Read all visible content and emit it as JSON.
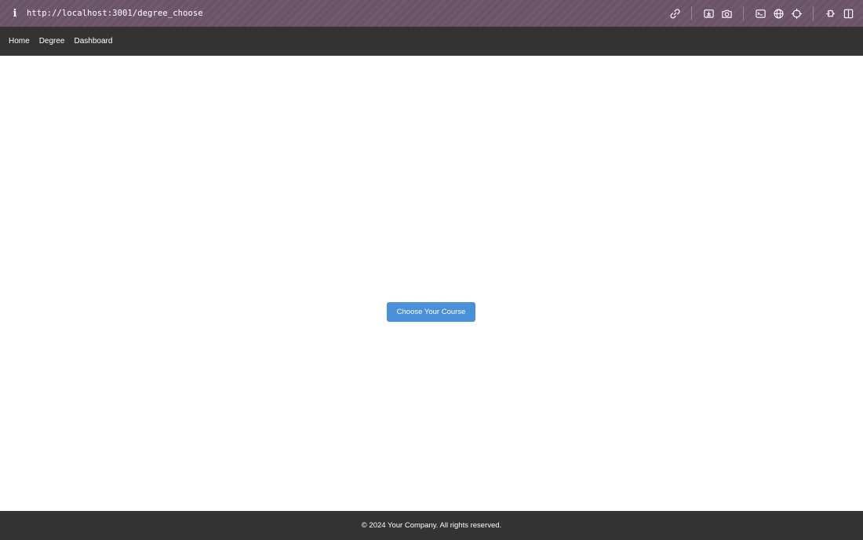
{
  "browser": {
    "info_icon": "i",
    "url": "http://localhost:3001/degree_choose",
    "toolbar_icons": [
      "link-icon",
      "download-icon",
      "camera-icon",
      "terminal-icon",
      "globe-icon",
      "crosshair-icon",
      "extensions-icon",
      "split-view-icon"
    ]
  },
  "nav": {
    "links": [
      {
        "label": "Home"
      },
      {
        "label": "Degree"
      },
      {
        "label": "Dashboard"
      }
    ]
  },
  "main": {
    "button_label": "Choose Your Course",
    "button_color": "#4a90d9"
  },
  "footer": {
    "text": "© 2024 Your Company. All rights reserved."
  },
  "colors": {
    "browser_bar": "#6b5368",
    "nav_bg": "#333333",
    "footer_bg": "#333333"
  }
}
